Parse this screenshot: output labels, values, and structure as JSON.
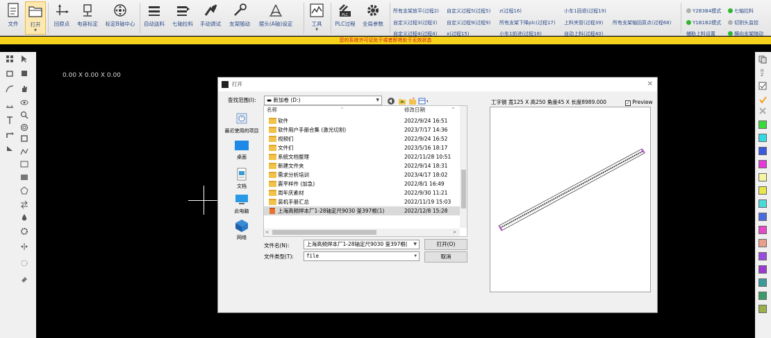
{
  "ribbon": {
    "buttons": [
      {
        "label": "文件",
        "icon": "file-icon"
      },
      {
        "label": "打开",
        "icon": "folder-open-icon"
      },
      {
        "label": "回原点",
        "icon": "origin-axes-icon"
      },
      {
        "label": "电容标定",
        "icon": "capacitance-calibrate-icon"
      },
      {
        "label": "标定B轴中心",
        "icon": "calibrate-center-icon"
      },
      {
        "label": "自动送料",
        "icon": "auto-feed-icon"
      },
      {
        "label": "七轴拉料",
        "icon": "seven-axis-pull-icon"
      },
      {
        "label": "手动调试",
        "icon": "manual-debug-icon"
      },
      {
        "label": "支架随动",
        "icon": "bracket-follow-icon"
      },
      {
        "label": "摆头(A轴)设定",
        "icon": "swing-head-icon"
      },
      {
        "label": "工具",
        "icon": "tools-icon"
      },
      {
        "label": "PLC过程",
        "icon": "plc-icon"
      },
      {
        "label": "全局参数",
        "icon": "gear-icon"
      }
    ],
    "process_links": [
      "所有支架放平(过程2)",
      "自定义过程5(过程5)",
      "z(过程16)",
      "小车1回退(过程19)",
      "自定义过程3(过程3)",
      "自定义过程9(过程9)",
      "所有支架下降plc(过程17)",
      "上料夹管(过程39)",
      "所有支架轴回原点(过程68)",
      "自定义过程4(过程4)",
      "x(过程15)",
      "小车1前进(过程18)",
      "自动上料(过程40)"
    ],
    "status": [
      {
        "label": "Y2B3B4模式",
        "color": "#b0b0b0"
      },
      {
        "label": "七轴拉料",
        "color": "#2fb52f"
      },
      {
        "label": "Y1B1B2模式",
        "color": "#2fb52f"
      },
      {
        "label": "切割头监控",
        "color": "#b0b0b0"
      },
      {
        "label": "辅助上料设置",
        "color": ""
      },
      {
        "label": "横向支架随动",
        "color": "#2fb52f"
      }
    ]
  },
  "warning": "您的系统许可证处于或者即将处于无效状态",
  "canvas": {
    "coords": "0.00 X 0.00 X 0.00"
  },
  "dialog": {
    "title": "打开",
    "lookin_label": "查找范围(I):",
    "lookin_value": "新加卷 (D:)",
    "places": [
      {
        "label": "最近使用的项目",
        "icon": "recent-icon"
      },
      {
        "label": "桌面",
        "icon": "desktop-icon"
      },
      {
        "label": "文档",
        "icon": "documents-icon"
      },
      {
        "label": "此电脑",
        "icon": "computer-icon"
      },
      {
        "label": "网络",
        "icon": "network-icon"
      }
    ],
    "columns": {
      "name": "名称",
      "date": "修改日期"
    },
    "files": [
      {
        "name": "软件",
        "date": "2022/9/24 16:51"
      },
      {
        "name": "软件用户手册合集 (激光切割)",
        "date": "2023/7/17 14:36"
      },
      {
        "name": "视频们",
        "date": "2022/9/24 16:52"
      },
      {
        "name": "文件们",
        "date": "2023/5/16 18:17"
      },
      {
        "name": "系统文档整理",
        "date": "2022/11/28 10:51"
      },
      {
        "name": "新建文件夹",
        "date": "2022/9/14 18:31"
      },
      {
        "name": "需求分析培训",
        "date": "2023/4/17 18:02"
      },
      {
        "name": "震平样件 (加急)",
        "date": "2022/8/1 16:49"
      },
      {
        "name": "周年庆素材",
        "date": "2022/9/30 11:21"
      },
      {
        "name": "装机手册汇总",
        "date": "2022/11/19 15:03"
      },
      {
        "name": "上海高频焊本厂1-28轴定尺9030 釜397根(1)",
        "date": "2022/12/8 15:28",
        "selected": true
      }
    ],
    "filename_label": "文件名(N):",
    "filename_value": "上海高频焊本厂1-28轴定尺9030 釜397根(",
    "filetype_label": "文件类型(T):",
    "filetype_value": "file",
    "open_button": "打开(O)",
    "cancel_button": "取消",
    "preview_info": "工字钢 宽125 X 高250 角度45 X 长度8989.000",
    "preview_label": "Preview",
    "preview_checked": true
  },
  "palette": [
    "#3ad93a",
    "#35d9e6",
    "#3a5be0",
    "#e33ad9",
    "#f5f5a0",
    "#e6e64a",
    "#4ad9d9",
    "#4a6ae0",
    "#e34ac8",
    "#e8a08a",
    "#9a4ae0",
    "#9a3ad0",
    "#3a9a9a",
    "#3a9a6a",
    "#9ab04a"
  ]
}
